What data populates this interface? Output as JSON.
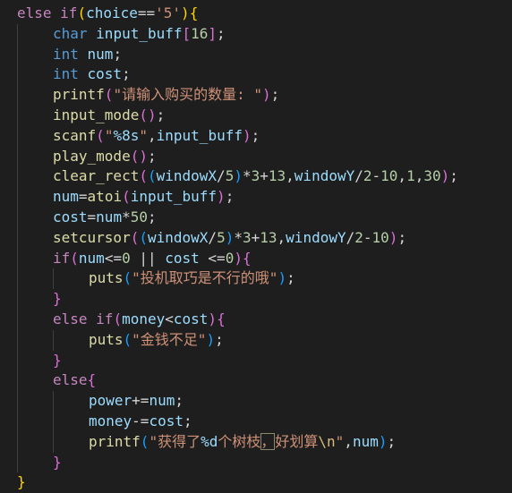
{
  "editor": {
    "language": "c",
    "colors": {
      "background": "#1e1e1e",
      "keyword": "#c586c0",
      "type": "#569cd6",
      "function": "#dcdcaa",
      "variable": "#9cdcfe",
      "string": "#ce9178",
      "number": "#b5cea8",
      "escape": "#d7ba7d",
      "bracket_level_1": "#ffd700",
      "bracket_level_2": "#da70d6",
      "bracket_level_3": "#179fff"
    },
    "lines": [
      [
        [
          "kw",
          "else "
        ],
        [
          "kw",
          "if"
        ],
        [
          "p1",
          "("
        ],
        [
          "var",
          "choice"
        ],
        [
          "op",
          "=="
        ],
        [
          "str",
          "'5'"
        ],
        [
          "p1",
          ")"
        ],
        [
          "p1",
          "{"
        ]
      ],
      [
        [
          "type",
          "char "
        ],
        [
          "var",
          "input_buff"
        ],
        [
          "p2",
          "["
        ],
        [
          "num",
          "16"
        ],
        [
          "p2",
          "]"
        ],
        [
          "op",
          ";"
        ]
      ],
      [
        [
          "type",
          "int "
        ],
        [
          "var",
          "num"
        ],
        [
          "op",
          ";"
        ]
      ],
      [
        [
          "type",
          "int "
        ],
        [
          "var",
          "cost"
        ],
        [
          "op",
          ";"
        ]
      ],
      [
        [
          "fn",
          "printf"
        ],
        [
          "p2",
          "("
        ],
        [
          "str",
          "\"请输入购买的数量: \""
        ],
        [
          "p2",
          ")"
        ],
        [
          "op",
          ";"
        ]
      ],
      [
        [
          "fn",
          "input_mode"
        ],
        [
          "p2",
          "()"
        ],
        [
          "op",
          ";"
        ]
      ],
      [
        [
          "fn",
          "scanf"
        ],
        [
          "p2",
          "("
        ],
        [
          "str",
          "\""
        ],
        [
          "fmt",
          "%8s"
        ],
        [
          "str",
          "\""
        ],
        [
          "op",
          ","
        ],
        [
          "var",
          "input_buff"
        ],
        [
          "p2",
          ")"
        ],
        [
          "op",
          ";"
        ]
      ],
      [
        [
          "fn",
          "play_mode"
        ],
        [
          "p2",
          "()"
        ],
        [
          "op",
          ";"
        ]
      ],
      [
        [
          "fn",
          "clear_rect"
        ],
        [
          "p2",
          "("
        ],
        [
          "p3",
          "("
        ],
        [
          "var",
          "windowX"
        ],
        [
          "op",
          "/"
        ],
        [
          "num",
          "5"
        ],
        [
          "p3",
          ")"
        ],
        [
          "op",
          "*"
        ],
        [
          "num",
          "3"
        ],
        [
          "op",
          "+"
        ],
        [
          "num",
          "13"
        ],
        [
          "op",
          ","
        ],
        [
          "var",
          "windowY"
        ],
        [
          "op",
          "/"
        ],
        [
          "num",
          "2"
        ],
        [
          "op",
          "-"
        ],
        [
          "num",
          "10"
        ],
        [
          "op",
          ","
        ],
        [
          "num",
          "1"
        ],
        [
          "op",
          ","
        ],
        [
          "num",
          "30"
        ],
        [
          "p2",
          ")"
        ],
        [
          "op",
          ";"
        ]
      ],
      [
        [
          "var",
          "num"
        ],
        [
          "op",
          "="
        ],
        [
          "fn",
          "atoi"
        ],
        [
          "p2",
          "("
        ],
        [
          "var",
          "input_buff"
        ],
        [
          "p2",
          ")"
        ],
        [
          "op",
          ";"
        ]
      ],
      [
        [
          "var",
          "cost"
        ],
        [
          "op",
          "="
        ],
        [
          "var",
          "num"
        ],
        [
          "op",
          "*"
        ],
        [
          "num",
          "50"
        ],
        [
          "op",
          ";"
        ]
      ],
      [
        [
          "fn",
          "setcursor"
        ],
        [
          "p2",
          "("
        ],
        [
          "p3",
          "("
        ],
        [
          "var",
          "windowX"
        ],
        [
          "op",
          "/"
        ],
        [
          "num",
          "5"
        ],
        [
          "p3",
          ")"
        ],
        [
          "op",
          "*"
        ],
        [
          "num",
          "3"
        ],
        [
          "op",
          "+"
        ],
        [
          "num",
          "13"
        ],
        [
          "op",
          ","
        ],
        [
          "var",
          "windowY"
        ],
        [
          "op",
          "/"
        ],
        [
          "num",
          "2"
        ],
        [
          "op",
          "-"
        ],
        [
          "num",
          "10"
        ],
        [
          "p2",
          ")"
        ],
        [
          "op",
          ";"
        ]
      ],
      [
        [
          "kw",
          "if"
        ],
        [
          "p2",
          "("
        ],
        [
          "var",
          "num"
        ],
        [
          "op",
          "<="
        ],
        [
          "num",
          "0"
        ],
        [
          "op",
          " || "
        ],
        [
          "var",
          "cost"
        ],
        [
          "op",
          " <="
        ],
        [
          "num",
          "0"
        ],
        [
          "p2",
          ")"
        ],
        [
          "p2",
          "{"
        ]
      ],
      [
        [
          "fn",
          "puts"
        ],
        [
          "p3",
          "("
        ],
        [
          "str",
          "\"投机取巧是不行的哦\""
        ],
        [
          "p3",
          ")"
        ],
        [
          "op",
          ";"
        ]
      ],
      [
        [
          "p2",
          "}"
        ]
      ],
      [
        [
          "kw",
          "else "
        ],
        [
          "kw",
          "if"
        ],
        [
          "p2",
          "("
        ],
        [
          "var",
          "money"
        ],
        [
          "op",
          "<"
        ],
        [
          "var",
          "cost"
        ],
        [
          "p2",
          ")"
        ],
        [
          "p2",
          "{"
        ]
      ],
      [
        [
          "fn",
          "puts"
        ],
        [
          "p3",
          "("
        ],
        [
          "str",
          "\"金钱不足\""
        ],
        [
          "p3",
          ")"
        ],
        [
          "op",
          ";"
        ]
      ],
      [
        [
          "p2",
          "}"
        ]
      ],
      [
        [
          "kw",
          "else"
        ],
        [
          "p2",
          "{"
        ]
      ],
      [
        [
          "var",
          "power"
        ],
        [
          "op",
          "+="
        ],
        [
          "var",
          "num"
        ],
        [
          "op",
          ";"
        ]
      ],
      [
        [
          "var",
          "money"
        ],
        [
          "op",
          "-="
        ],
        [
          "var",
          "cost"
        ],
        [
          "op",
          ";"
        ]
      ],
      [
        [
          "fn",
          "printf"
        ],
        [
          "p3",
          "("
        ],
        [
          "str",
          "\"获得了"
        ],
        [
          "fmt",
          "%d"
        ],
        [
          "str",
          "个树枝"
        ],
        [
          "cursor",
          "，"
        ],
        [
          "str",
          "好划算"
        ],
        [
          "esc",
          "\\n"
        ],
        [
          "str",
          "\""
        ],
        [
          "op",
          ","
        ],
        [
          "var",
          "num"
        ],
        [
          "p3",
          ")"
        ],
        [
          "op",
          ";"
        ]
      ],
      [
        [
          "p2",
          "}"
        ]
      ],
      [
        [
          "p1",
          "}"
        ]
      ]
    ]
  }
}
